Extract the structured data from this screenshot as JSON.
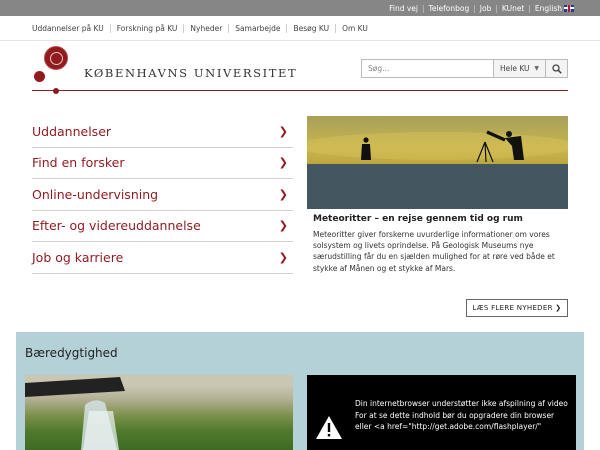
{
  "topbar": {
    "links": [
      "Find vej",
      "Telefonbog",
      "Job",
      "KUnet",
      "English"
    ],
    "flag_icon": "uk-flag-icon"
  },
  "mainnav": {
    "items": [
      "Uddannelser på KU",
      "Forskning på KU",
      "Nyheder",
      "Samarbejde",
      "Besøg KU",
      "Om KU"
    ]
  },
  "logo": {
    "wordmark": "KØBENHAVNS UNIVERSITET",
    "seal_icon": "university-seal-icon"
  },
  "search": {
    "placeholder": "Søg...",
    "scope": "Hele KU",
    "scope_icon": "caret-down-icon",
    "button_icon": "search-icon"
  },
  "quicklinks": {
    "items": [
      "Uddannelser",
      "Find en forsker",
      "Online-undervisning",
      "Efter- og videreuddannelse",
      "Job og karriere"
    ],
    "chevron": "❯"
  },
  "news": {
    "title": "Meteoritter – en rejse gennem tid og rum",
    "body": "Meteoritter giver forskerne uvurderlige informationer om vores solsystem og livets oprindelse. På Geologisk Museums nye særudstilling får du en sjælden mulighed for at røre ved både et stykke af Månen og et stykke af Mars.",
    "more_label": "LÆS FLERE NYHEDER ❯"
  },
  "sustainability": {
    "heading": "Bæredygtighed",
    "video_text": "Din internetbrowser understøtter ikke afspilning af video\nFor at se dette indhold bør du opgradere din browser eller <a href=\"http://get.adobe.com/flashplayer/\"",
    "warning_icon": "warning-icon"
  },
  "colors": {
    "accent": "#901a1e",
    "topbar": "#868686",
    "panel": "#b5d1d8"
  }
}
